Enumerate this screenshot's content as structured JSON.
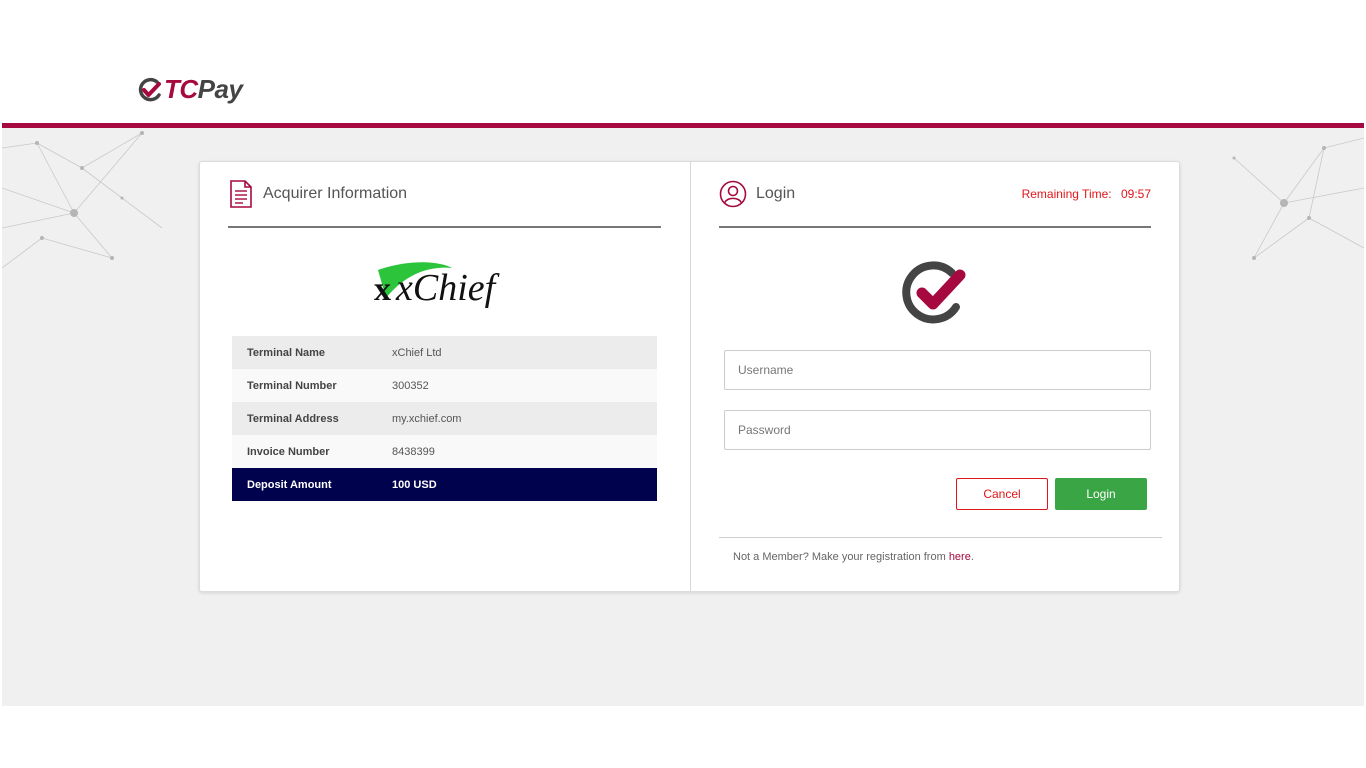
{
  "brand": {
    "name_part1": "TC",
    "name_part2": "Pay",
    "accent": "#a6093f"
  },
  "acquirer": {
    "title": "Acquirer Information",
    "icon": "document-icon",
    "merchant_logo_text": "xChief",
    "rows": [
      {
        "label": "Terminal Name",
        "value": "xChief Ltd"
      },
      {
        "label": "Terminal Number",
        "value": "300352"
      },
      {
        "label": "Terminal Address",
        "value": "my.xchief.com"
      },
      {
        "label": "Invoice Number",
        "value": "8438399"
      }
    ],
    "total": {
      "label": "Deposit Amount",
      "value": "100 USD"
    }
  },
  "login": {
    "title": "Login",
    "icon": "user-circle-icon",
    "remaining_label": "Remaining Time:",
    "remaining_value": "09:57",
    "username_placeholder": "Username",
    "password_placeholder": "Password",
    "cancel_label": "Cancel",
    "login_label": "Login",
    "register_text": "Not a Member? Make your registration from ",
    "register_link": "here",
    "register_suffix": "."
  },
  "colors": {
    "accent": "#a6093f",
    "navy": "#01024e",
    "success": "#3aa545",
    "danger": "#e0161b"
  }
}
